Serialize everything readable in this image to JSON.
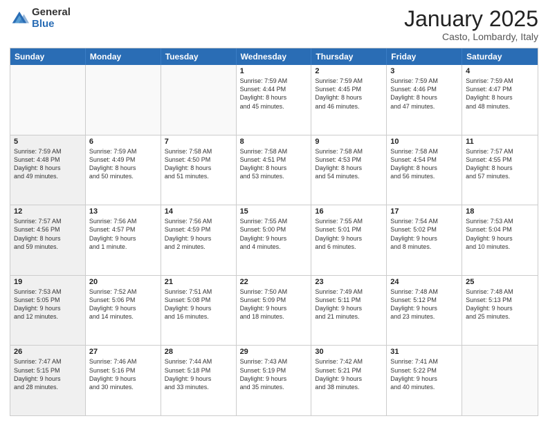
{
  "logo": {
    "general": "General",
    "blue": "Blue"
  },
  "title": "January 2025",
  "subtitle": "Casto, Lombardy, Italy",
  "header_days": [
    "Sunday",
    "Monday",
    "Tuesday",
    "Wednesday",
    "Thursday",
    "Friday",
    "Saturday"
  ],
  "weeks": [
    [
      {
        "day": "",
        "info": "",
        "shaded": true
      },
      {
        "day": "",
        "info": "",
        "shaded": true
      },
      {
        "day": "",
        "info": "",
        "shaded": true
      },
      {
        "day": "1",
        "info": "Sunrise: 7:59 AM\nSunset: 4:44 PM\nDaylight: 8 hours\nand 45 minutes.",
        "shaded": false
      },
      {
        "day": "2",
        "info": "Sunrise: 7:59 AM\nSunset: 4:45 PM\nDaylight: 8 hours\nand 46 minutes.",
        "shaded": false
      },
      {
        "day": "3",
        "info": "Sunrise: 7:59 AM\nSunset: 4:46 PM\nDaylight: 8 hours\nand 47 minutes.",
        "shaded": false
      },
      {
        "day": "4",
        "info": "Sunrise: 7:59 AM\nSunset: 4:47 PM\nDaylight: 8 hours\nand 48 minutes.",
        "shaded": false
      }
    ],
    [
      {
        "day": "5",
        "info": "Sunrise: 7:59 AM\nSunset: 4:48 PM\nDaylight: 8 hours\nand 49 minutes.",
        "shaded": true
      },
      {
        "day": "6",
        "info": "Sunrise: 7:59 AM\nSunset: 4:49 PM\nDaylight: 8 hours\nand 50 minutes.",
        "shaded": false
      },
      {
        "day": "7",
        "info": "Sunrise: 7:58 AM\nSunset: 4:50 PM\nDaylight: 8 hours\nand 51 minutes.",
        "shaded": false
      },
      {
        "day": "8",
        "info": "Sunrise: 7:58 AM\nSunset: 4:51 PM\nDaylight: 8 hours\nand 53 minutes.",
        "shaded": false
      },
      {
        "day": "9",
        "info": "Sunrise: 7:58 AM\nSunset: 4:53 PM\nDaylight: 8 hours\nand 54 minutes.",
        "shaded": false
      },
      {
        "day": "10",
        "info": "Sunrise: 7:58 AM\nSunset: 4:54 PM\nDaylight: 8 hours\nand 56 minutes.",
        "shaded": false
      },
      {
        "day": "11",
        "info": "Sunrise: 7:57 AM\nSunset: 4:55 PM\nDaylight: 8 hours\nand 57 minutes.",
        "shaded": false
      }
    ],
    [
      {
        "day": "12",
        "info": "Sunrise: 7:57 AM\nSunset: 4:56 PM\nDaylight: 8 hours\nand 59 minutes.",
        "shaded": true
      },
      {
        "day": "13",
        "info": "Sunrise: 7:56 AM\nSunset: 4:57 PM\nDaylight: 9 hours\nand 1 minute.",
        "shaded": false
      },
      {
        "day": "14",
        "info": "Sunrise: 7:56 AM\nSunset: 4:59 PM\nDaylight: 9 hours\nand 2 minutes.",
        "shaded": false
      },
      {
        "day": "15",
        "info": "Sunrise: 7:55 AM\nSunset: 5:00 PM\nDaylight: 9 hours\nand 4 minutes.",
        "shaded": false
      },
      {
        "day": "16",
        "info": "Sunrise: 7:55 AM\nSunset: 5:01 PM\nDaylight: 9 hours\nand 6 minutes.",
        "shaded": false
      },
      {
        "day": "17",
        "info": "Sunrise: 7:54 AM\nSunset: 5:02 PM\nDaylight: 9 hours\nand 8 minutes.",
        "shaded": false
      },
      {
        "day": "18",
        "info": "Sunrise: 7:53 AM\nSunset: 5:04 PM\nDaylight: 9 hours\nand 10 minutes.",
        "shaded": false
      }
    ],
    [
      {
        "day": "19",
        "info": "Sunrise: 7:53 AM\nSunset: 5:05 PM\nDaylight: 9 hours\nand 12 minutes.",
        "shaded": true
      },
      {
        "day": "20",
        "info": "Sunrise: 7:52 AM\nSunset: 5:06 PM\nDaylight: 9 hours\nand 14 minutes.",
        "shaded": false
      },
      {
        "day": "21",
        "info": "Sunrise: 7:51 AM\nSunset: 5:08 PM\nDaylight: 9 hours\nand 16 minutes.",
        "shaded": false
      },
      {
        "day": "22",
        "info": "Sunrise: 7:50 AM\nSunset: 5:09 PM\nDaylight: 9 hours\nand 18 minutes.",
        "shaded": false
      },
      {
        "day": "23",
        "info": "Sunrise: 7:49 AM\nSunset: 5:11 PM\nDaylight: 9 hours\nand 21 minutes.",
        "shaded": false
      },
      {
        "day": "24",
        "info": "Sunrise: 7:48 AM\nSunset: 5:12 PM\nDaylight: 9 hours\nand 23 minutes.",
        "shaded": false
      },
      {
        "day": "25",
        "info": "Sunrise: 7:48 AM\nSunset: 5:13 PM\nDaylight: 9 hours\nand 25 minutes.",
        "shaded": false
      }
    ],
    [
      {
        "day": "26",
        "info": "Sunrise: 7:47 AM\nSunset: 5:15 PM\nDaylight: 9 hours\nand 28 minutes.",
        "shaded": true
      },
      {
        "day": "27",
        "info": "Sunrise: 7:46 AM\nSunset: 5:16 PM\nDaylight: 9 hours\nand 30 minutes.",
        "shaded": false
      },
      {
        "day": "28",
        "info": "Sunrise: 7:44 AM\nSunset: 5:18 PM\nDaylight: 9 hours\nand 33 minutes.",
        "shaded": false
      },
      {
        "day": "29",
        "info": "Sunrise: 7:43 AM\nSunset: 5:19 PM\nDaylight: 9 hours\nand 35 minutes.",
        "shaded": false
      },
      {
        "day": "30",
        "info": "Sunrise: 7:42 AM\nSunset: 5:21 PM\nDaylight: 9 hours\nand 38 minutes.",
        "shaded": false
      },
      {
        "day": "31",
        "info": "Sunrise: 7:41 AM\nSunset: 5:22 PM\nDaylight: 9 hours\nand 40 minutes.",
        "shaded": false
      },
      {
        "day": "",
        "info": "",
        "shaded": true
      }
    ]
  ]
}
